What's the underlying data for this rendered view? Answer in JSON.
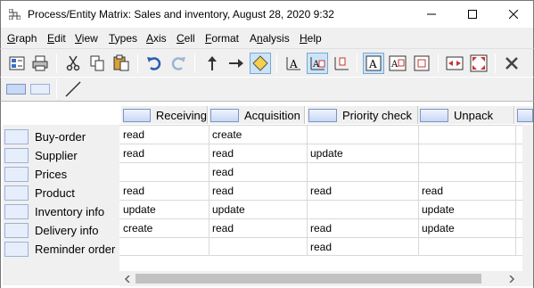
{
  "window": {
    "title": "Process/Entity Matrix: Sales and inventory, August 28, 2020 9:32",
    "icons": [
      "app-matrix-icon",
      "minimize-icon",
      "maximize-icon",
      "close-icon"
    ]
  },
  "menu": [
    {
      "u": "G",
      "rest": "raph"
    },
    {
      "u": "E",
      "rest": "dit"
    },
    {
      "u": "V",
      "rest": "iew"
    },
    {
      "u": "T",
      "rest": "ypes"
    },
    {
      "u": "A",
      "rest": "xis"
    },
    {
      "u": "C",
      "rest": "ell"
    },
    {
      "u": "F",
      "rest": "ormat"
    },
    {
      "u": "",
      "rest": "Analysis",
      "pre": "A",
      "mid": "n",
      "post": "alysis"
    },
    {
      "u": "H",
      "rest": "elp"
    }
  ],
  "toolbar1_icons": [
    "properties-icon",
    "print-icon",
    "cut-icon",
    "copy-icon",
    "paste-icon",
    "undo-icon",
    "redo-icon",
    "arrow-up-icon",
    "arrow-right-icon",
    "diamond-icon",
    "text-align-bottom-icon",
    "text-align-center-icon",
    "text-align-top-icon",
    "cell-text-icon",
    "cell-text-chip-icon",
    "cell-chip-icon",
    "columns-fit-icon",
    "fit-all-icon",
    "delete-icon"
  ],
  "toolbar2_icons": [
    "header-chip-icon",
    "row-chip-icon",
    "line-icon"
  ],
  "matrix": {
    "columns": [
      "Receiving",
      "Acquisition",
      "Priority check",
      "Unpack"
    ],
    "rows": [
      "Buy-order",
      "Supplier",
      "Prices",
      "Product",
      "Inventory info",
      "Delivery info",
      "Reminder order"
    ],
    "cells": [
      [
        "read",
        "create",
        "",
        ""
      ],
      [
        "read",
        "read",
        "update",
        ""
      ],
      [
        "",
        "read",
        "",
        ""
      ],
      [
        "read",
        "read",
        "read",
        "read"
      ],
      [
        "update",
        "update",
        "",
        "update"
      ],
      [
        "create",
        "read",
        "read",
        "update"
      ],
      [
        "",
        "",
        "read",
        ""
      ]
    ]
  }
}
